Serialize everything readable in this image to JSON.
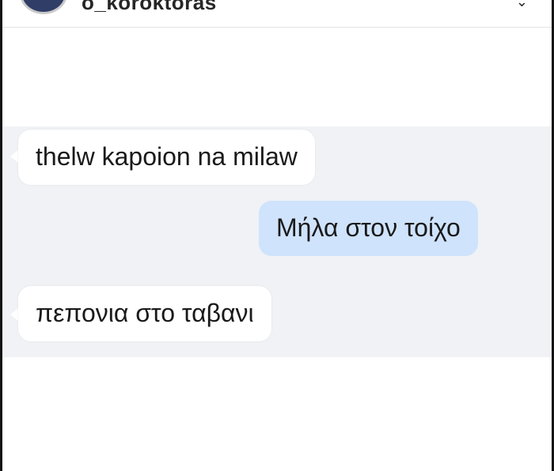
{
  "header": {
    "username": "o_koroktoras",
    "chevron": "⌄"
  },
  "messages": [
    {
      "direction": "incoming",
      "text": "thelw kapoion na milaw"
    },
    {
      "direction": "outgoing",
      "text": "Μήλα στον τοίχο"
    },
    {
      "direction": "incoming",
      "text": "πεπονια στο ταβανι"
    }
  ],
  "colors": {
    "chat_background": "#f0f2f5",
    "incoming_bubble": "#ffffff",
    "outgoing_bubble": "#cfe3fc",
    "avatar": "#2f3d67"
  },
  "icons": {
    "header_chevron": "chevron-down-icon"
  }
}
